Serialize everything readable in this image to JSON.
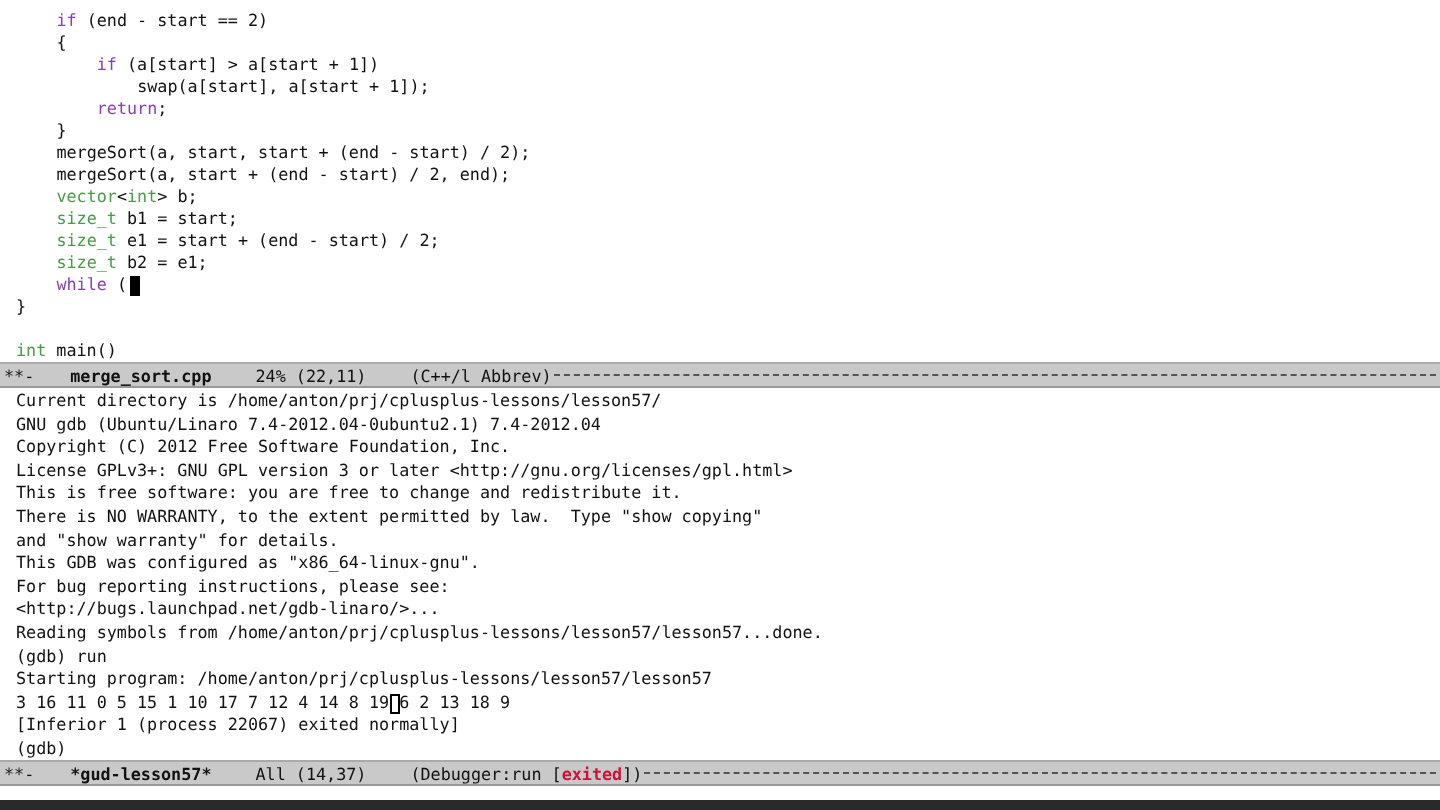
{
  "editor": {
    "focused": true,
    "blocks": [
      [
        {
          "children": [
            {
              "segments": [
                {
                  "text": "if",
                  "kind": "keyword"
                },
                {
                  "text": " (end - start == 2)",
                  "kind": "plain"
                }
              ]
            },
            {
              "segments": [
                {
                  "text": "{",
                  "kind": "plain"
                }
              ],
              "children": [
                {
                  "segments": [
                    {
                      "text": "if",
                      "kind": "keyword"
                    },
                    {
                      "text": " (a[start] > a[start + 1])",
                      "kind": "plain"
                    }
                  ],
                  "children": [
                    {
                      "segments": [
                        {
                          "text": "swap(a[start], a[start + 1]);",
                          "kind": "plain"
                        }
                      ]
                    }
                  ]
                },
                {
                  "segments": [
                    {
                      "text": "return",
                      "kind": "keyword"
                    },
                    {
                      "text": ";",
                      "kind": "plain"
                    }
                  ]
                }
              ]
            },
            {
              "segments": [
                {
                  "text": "}",
                  "kind": "plain"
                }
              ]
            },
            {
              "segments": [
                {
                  "text": "mergeSort(a, start, start + (end - start) / 2);",
                  "kind": "plain"
                }
              ]
            },
            {
              "segments": [
                {
                  "text": "mergeSort(a, start + (end - start) / 2, end);",
                  "kind": "plain"
                }
              ]
            },
            {
              "segments": [
                {
                  "text": "vector",
                  "kind": "type"
                },
                {
                  "text": "<",
                  "kind": "plain"
                },
                {
                  "text": "int",
                  "kind": "type"
                },
                {
                  "text": "> b;",
                  "kind": "plain"
                }
              ]
            },
            {
              "segments": [
                {
                  "text": "size_t",
                  "kind": "type"
                },
                {
                  "text": " b1 = start;",
                  "kind": "plain"
                }
              ]
            },
            {
              "segments": [
                {
                  "text": "size_t",
                  "kind": "type"
                },
                {
                  "text": " e1 = start + (end - start) / 2;",
                  "kind": "plain"
                }
              ]
            },
            {
              "segments": [
                {
                  "text": "size_t",
                  "kind": "type"
                },
                {
                  "text": " b2 = e1;",
                  "kind": "plain"
                }
              ]
            },
            {
              "segments": [
                {
                  "text": "while",
                  "kind": "keyword"
                },
                {
                  "text": " (",
                  "kind": "plain"
                }
              ],
              "cursor": true
            }
          ]
        },
        {
          "segments": [
            {
              "text": "}",
              "kind": "plain"
            }
          ]
        }
      ],
      [
        {
          "segments": [
            {
              "text": "int",
              "kind": "type"
            },
            {
              "text": " main()",
              "kind": "plain"
            }
          ]
        }
      ]
    ],
    "mode_line": {
      "flags": "**-",
      "buffer": "merge_sort.cpp",
      "position": "24% (22,11)",
      "modes": [
        {
          "text": "(C++/l Abbrev)",
          "kind": "plain"
        }
      ]
    }
  },
  "gdb": {
    "focused": false,
    "lines": [
      {
        "text": "Current directory is /home/anton/prj/cplusplus-lessons/lesson57/"
      },
      {
        "text": "GNU gdb (Ubuntu/Linaro 7.4-2012.04-0ubuntu2.1) 7.4-2012.04"
      },
      {
        "text": "Copyright (C) 2012 Free Software Foundation, Inc."
      },
      {
        "text": "License GPLv3+: GNU GPL version 3 or later <http://gnu.org/licenses/gpl.html>"
      },
      {
        "text": "This is free software: you are free to change and redistribute it."
      },
      {
        "text": "There is NO WARRANTY, to the extent permitted by law.  Type \"show copying\""
      },
      {
        "text": "and \"show warranty\" for details."
      },
      {
        "text": "This GDB was configured as \"x86_64-linux-gnu\"."
      },
      {
        "text": "For bug reporting instructions, please see:"
      },
      {
        "text": "<http://bugs.launchpad.net/gdb-linaro/>..."
      },
      {
        "text": "Reading symbols from /home/anton/prj/cplusplus-lessons/lesson57/lesson57...done."
      },
      {
        "text": "(gdb) run"
      },
      {
        "text": "Starting program: /home/anton/prj/cplusplus-lessons/lesson57/lesson57"
      },
      {
        "text": "3 16 11 0 5 15 1 10 17 7 12 4 14 8 19",
        "cursor": true,
        "after": "6 2 13 18 9"
      },
      {
        "text": "[Inferior 1 (process 22067) exited normally]"
      },
      {
        "text": "(gdb)"
      }
    ],
    "mode_line": {
      "flags": "**-",
      "buffer": "*gud-lesson57*",
      "position": "All (14,37)",
      "modes": [
        {
          "text": "(Debugger:run [",
          "kind": "plain"
        },
        {
          "text": "exited",
          "kind": "alert"
        },
        {
          "text": "])",
          "kind": "plain"
        }
      ]
    }
  }
}
